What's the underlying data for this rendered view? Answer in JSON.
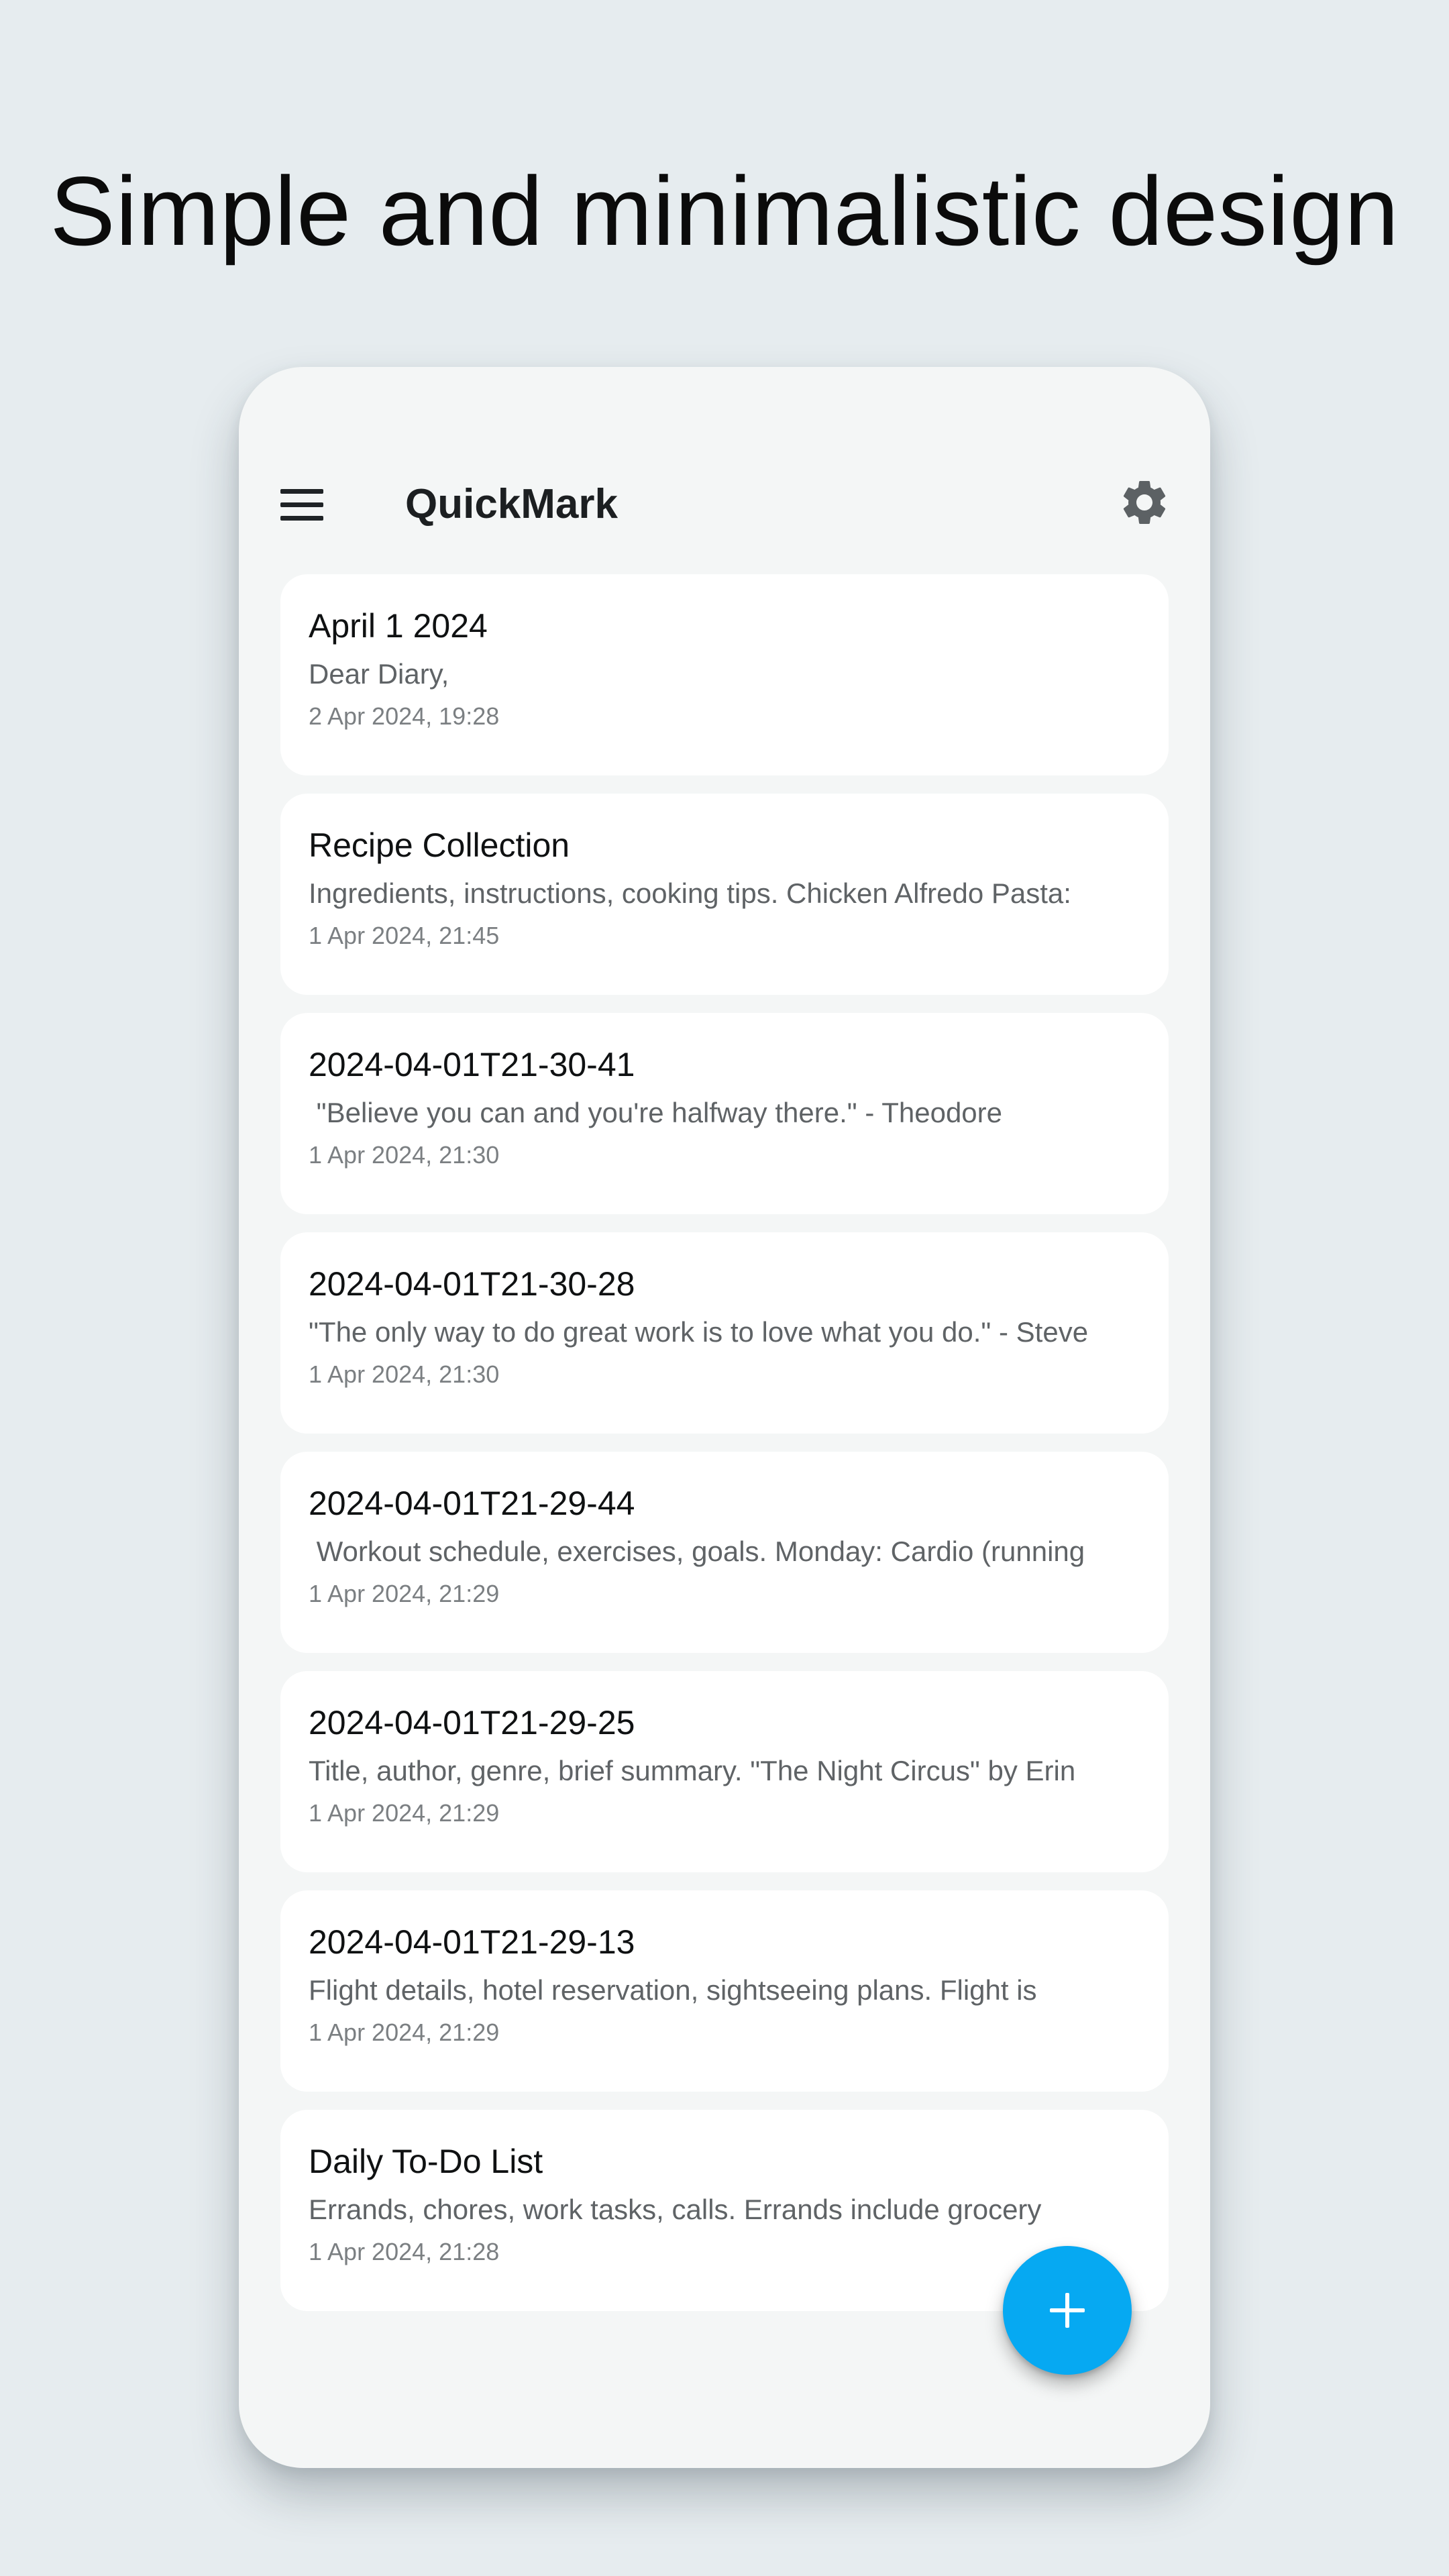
{
  "headline": "Simple and minimalistic design",
  "app": {
    "title": "QuickMark",
    "icons": {
      "menu": "hamburger-menu-icon",
      "settings": "gear-icon",
      "add": "plus-icon"
    },
    "colors": {
      "fab": "#06a9f2",
      "background": "#e6ecef",
      "phone_background": "#f4f6f6",
      "card_background": "#ffffff"
    }
  },
  "notes": [
    {
      "title": "April 1 2024",
      "body": "Dear Diary,",
      "date": "2 Apr 2024, 19:28"
    },
    {
      "title": "Recipe Collection",
      "body": "Ingredients, instructions, cooking tips. Chicken Alfredo Pasta:",
      "date": "1 Apr 2024, 21:45"
    },
    {
      "title": "2024-04-01T21-30-41",
      "body": " \"Believe you can and you're halfway there.\" - Theodore",
      "date": "1 Apr 2024, 21:30"
    },
    {
      "title": "2024-04-01T21-30-28",
      "body": "\"The only way to do great work is to love what you do.\" - Steve",
      "date": "1 Apr 2024, 21:30"
    },
    {
      "title": "2024-04-01T21-29-44",
      "body": " Workout schedule, exercises, goals. Monday: Cardio (running",
      "date": "1 Apr 2024, 21:29"
    },
    {
      "title": "2024-04-01T21-29-25",
      "body": "Title, author, genre, brief summary. \"The Night Circus\" by Erin",
      "date": "1 Apr 2024, 21:29"
    },
    {
      "title": "2024-04-01T21-29-13",
      "body": "Flight details, hotel reservation, sightseeing plans. Flight is",
      "date": "1 Apr 2024, 21:29"
    },
    {
      "title": "Daily To-Do List",
      "body": "Errands, chores, work tasks, calls. Errands include grocery",
      "date": "1 Apr 2024, 21:28"
    }
  ]
}
